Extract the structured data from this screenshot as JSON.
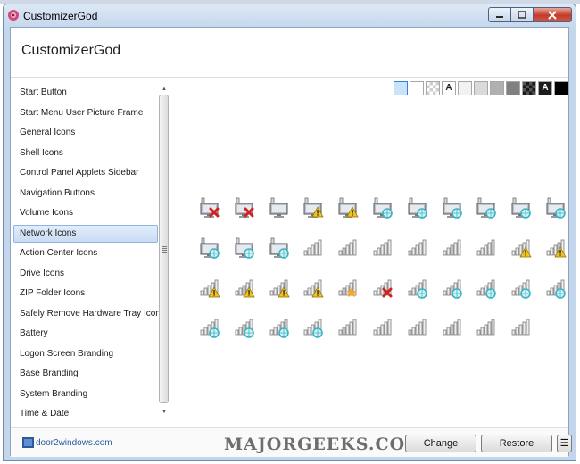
{
  "window": {
    "title": "CustomizerGod"
  },
  "header": {
    "title": "CustomizerGod"
  },
  "sidebar": {
    "items": [
      {
        "label": "Start Button"
      },
      {
        "label": "Start Menu User Picture Frame"
      },
      {
        "label": "General Icons"
      },
      {
        "label": "Shell Icons"
      },
      {
        "label": "Control Panel Applets Sidebar"
      },
      {
        "label": "Navigation Buttons"
      },
      {
        "label": "Volume Icons"
      },
      {
        "label": "Network Icons"
      },
      {
        "label": "Action Center Icons"
      },
      {
        "label": "Drive Icons"
      },
      {
        "label": "ZIP Folder Icons"
      },
      {
        "label": "Safely Remove Hardware Tray Icon"
      },
      {
        "label": "Battery"
      },
      {
        "label": "Logon Screen Branding"
      },
      {
        "label": "Base Branding"
      },
      {
        "label": "System Branding"
      },
      {
        "label": "Time & Date"
      }
    ],
    "selected": "Network Icons"
  },
  "background_selector": {
    "swatches": [
      {
        "fill": "#c9e3fb",
        "glyph": ""
      },
      {
        "fill": "#ffffff",
        "glyph": ""
      },
      {
        "fill": "checker",
        "glyph": ""
      },
      {
        "fill": "#ffffff",
        "glyph": "A"
      },
      {
        "fill": "#f2f2f2",
        "glyph": ""
      },
      {
        "fill": "#dadada",
        "glyph": ""
      },
      {
        "fill": "#b0b0b0",
        "glyph": ""
      },
      {
        "fill": "#808080",
        "glyph": ""
      },
      {
        "fill": "dark-checker",
        "glyph": ""
      },
      {
        "fill": "#1c1c1c",
        "glyph": "A"
      },
      {
        "fill": "#000000",
        "glyph": ""
      }
    ],
    "selected_index": 0
  },
  "network_icons": {
    "rows": [
      [
        "monitor-error",
        "monitor-error",
        "monitor",
        "monitor-warning",
        "monitor-warning",
        "monitor-globe",
        "monitor-globe",
        "monitor-globe",
        "monitor-globe",
        "monitor-globe",
        "monitor-globe"
      ],
      [
        "monitor-globe",
        "monitor-globe",
        "monitor-globe",
        "signal-bars",
        "signal-bars",
        "signal-bars",
        "signal-bars",
        "signal-bars",
        "signal-bars",
        "signal-warning",
        "signal-warning"
      ],
      [
        "signal-warning",
        "signal-warning",
        "signal-warning",
        "signal-warning",
        "signal-star",
        "signal-error",
        "signal-globe",
        "signal-globe",
        "signal-globe",
        "signal-globe",
        "signal-globe"
      ],
      [
        "signal-globe",
        "signal-globe",
        "signal-globe",
        "signal-globe",
        "signal-bars",
        "signal-bars",
        "signal-bars",
        "signal-bars",
        "signal-bars",
        "signal-bars"
      ]
    ]
  },
  "footer": {
    "brand": "door2windows.com",
    "watermark": "MAJORGEEKS.COM",
    "change_label": "Change",
    "restore_label": "Restore",
    "menu_glyph": "☰"
  },
  "colors": {
    "accent": "#8fb4e3",
    "error": "#d21f1f",
    "warning": "#f0c419",
    "globe": "#3bb3c3",
    "star": "#f7a81b"
  }
}
